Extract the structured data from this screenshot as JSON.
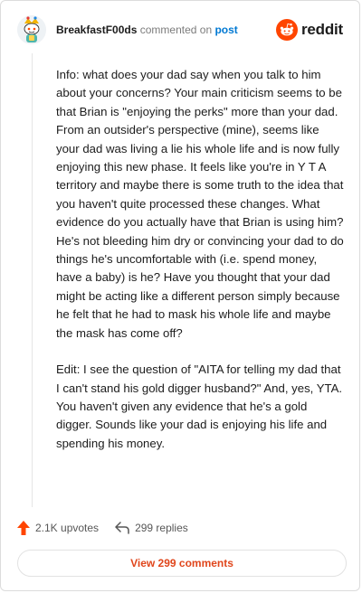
{
  "comment": {
    "username": "BreakfastF00ds",
    "commented_on_text": "commented on",
    "post_link_text": "post",
    "brand_name": "reddit",
    "paragraphs": [
      "Info: what does your dad say when you talk to him about your concerns? Your main criticism seems to be that Brian is \"enjoying the perks\" more than your dad. From an outsider's perspective (mine), seems like your dad was living a lie his whole life and is now fully enjoying this new phase. It feels like you're in Y T A territory and maybe there is some truth to the idea that you haven't quite processed these changes. What evidence do you actually have that Brian is using him? He's not bleeding him dry or convincing your dad to do things he's uncomfortable with (i.e. spend money, have a baby) is he? Have you thought that your dad might be acting like a different person simply because he felt that he had to mask his whole life and maybe the mask has come off?",
      "Edit: I see the question of \"AITA for telling my dad that I can't stand his gold digger husband?\" And, yes, YTA. You haven't given any evidence that he's a gold digger. Sounds like your dad is enjoying his life and spending his money."
    ],
    "upvotes": "2.1K upvotes",
    "replies": "299 replies",
    "view_comments_label": "View 299 comments"
  },
  "colors": {
    "brand_orange": "#ff4500",
    "link_blue": "#0079d3",
    "button_text": "#e0461c"
  },
  "icons": {
    "avatar": "snoo-avatar",
    "brand": "reddit-logo-icon",
    "upvote": "upvote-arrow-icon",
    "reply": "reply-arrow-icon"
  }
}
